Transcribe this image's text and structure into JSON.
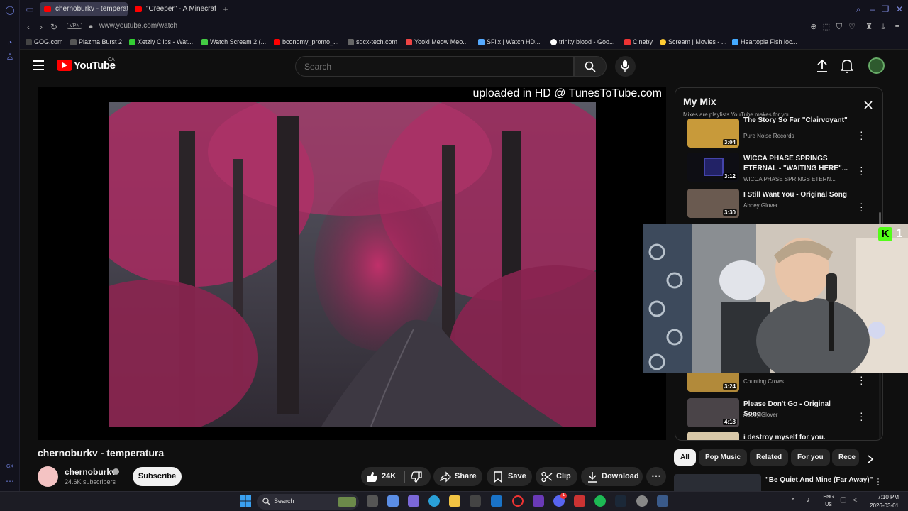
{
  "browser": {
    "tabs": [
      {
        "label": "chernoburkv - temperatura",
        "active": true
      },
      {
        "label": "\"Creeper\" - A Minecraft Pa",
        "active": false
      }
    ],
    "url": "www.youtube.com/watch",
    "vpn_label": "VPN",
    "bookmarks": [
      "GOG.com",
      "Plazma Burst 2",
      "Xetzly Clips - Wat...",
      "Watch Scream 2 (...",
      "bconomy_promo_...",
      "sdcx-tech.com",
      "Yooki Meow Meo...",
      "SFlix | Watch HD...",
      "trinity blood - Goo...",
      "Cineby",
      "Scream | Movies - ...",
      "Heartopia Fish loc..."
    ],
    "gx_label": "GX"
  },
  "youtube": {
    "wordmark": "YouTube",
    "country": "CA",
    "search_placeholder": "Search"
  },
  "video": {
    "watermark": "uploaded in HD @ TunesToTube.com",
    "title": "chernoburkv - temperatura",
    "channel": "chernoburkv",
    "subscribers": "24.6K subscribers",
    "subscribe_label": "Subscribe",
    "likes": "24K",
    "share_label": "Share",
    "save_label": "Save",
    "clip_label": "Clip",
    "download_label": "Download"
  },
  "playlist": {
    "title": "My Mix",
    "subtitle": "Mixes are playlists YouTube makes for you",
    "items": [
      {
        "name": "The Story So Far \"Clairvoyant\"",
        "artist": "Pure Noise Records",
        "duration": "3:04"
      },
      {
        "name": "WICCA PHASE SPRINGS ETERNAL - \"WAITING HERE\"...",
        "artist": "WICCA PHASE SPRINGS ETERN...",
        "duration": "3:12"
      },
      {
        "name": "I Still Want You - Original Song",
        "artist": "Abbey Glover",
        "duration": "3:30"
      },
      {
        "name": "",
        "artist": "Counting Crows",
        "duration": "3:24"
      },
      {
        "name": "Please Don't Go - Original Song",
        "artist": "Abbey Glover",
        "duration": "4:18"
      },
      {
        "name": "i destroy myself for you.",
        "artist": "",
        "duration": ""
      }
    ]
  },
  "chips": [
    "All",
    "Pop Music",
    "Related",
    "For you",
    "Rece"
  ],
  "next_video": {
    "title": "\"Be Quiet And Mine (Far Away)\""
  },
  "webcam": {
    "kick_count": "1",
    "kick_letter": "K"
  },
  "taskbar": {
    "search_label": "Search",
    "lang": "ENG",
    "region": "US",
    "time": "7:10 PM",
    "date": "2026-03-01",
    "discord_badge": "1"
  },
  "colors": {
    "youtube_red": "#ff0000",
    "kick_green": "#53fc18",
    "accent": "#7a86d8"
  }
}
